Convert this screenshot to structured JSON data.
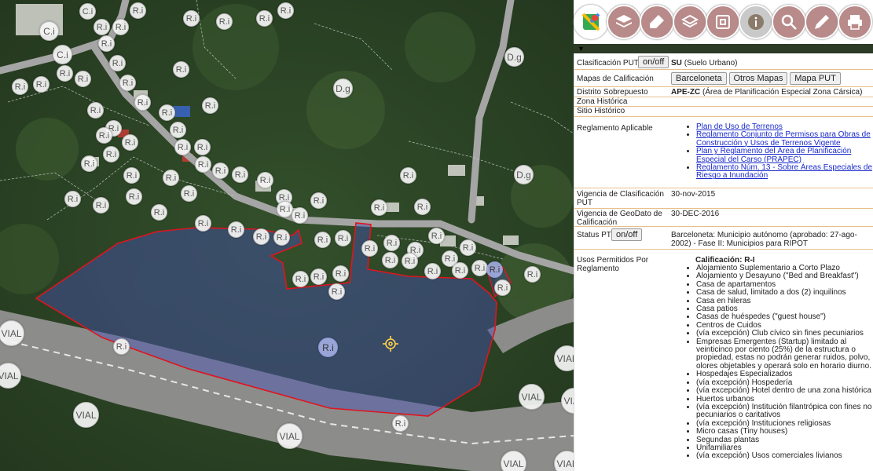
{
  "map": {
    "layer_labels": {
      "ri": "R.i",
      "ci": "C.i",
      "dg": "D.g",
      "vial": "VIAL"
    },
    "location_marker": "crosshair-icon",
    "colors": {
      "parcel_outline": "#e0141e",
      "selected_parcel_fill": "rgba(70,80,180,0.45)",
      "road": "#9a9a9a"
    }
  },
  "toolbar": {
    "buttons": [
      {
        "name": "google-maps-button",
        "icon": "google-maps-icon"
      },
      {
        "name": "layers-button",
        "icon": "layers-icon"
      },
      {
        "name": "eraser-button",
        "icon": "eraser-icon"
      },
      {
        "name": "basemap-button",
        "icon": "stack-icon"
      },
      {
        "name": "gis-button",
        "icon": "gis-icon"
      },
      {
        "name": "info-button",
        "icon": "info-icon"
      },
      {
        "name": "search-button",
        "icon": "magnifier-icon"
      },
      {
        "name": "measure-button",
        "icon": "pencil-icon"
      },
      {
        "name": "print-button",
        "icon": "printer-icon"
      }
    ]
  },
  "panel": {
    "clasificacion_label": "Clasificación PUT",
    "clasificacion_btn": "on/off",
    "clasificacion_code": "SU",
    "clasificacion_desc": "(Suelo Urbano)",
    "mapas_label": "Mapas de Calificación",
    "mapas_buttons": [
      "Barceloneta",
      "Otros Mapas",
      "Mapa PUT"
    ],
    "distrito_label": "Distrito Sobrepuesto",
    "distrito_code": "APE-ZC",
    "distrito_desc": "(Área de Planificación Especial Zona Cársica)",
    "zona_label": "Zona Histórica",
    "sitio_label": "Sitio Histórico",
    "reglamento_label": "Reglamento Aplicable",
    "reglamento_links": [
      "Plan de Uso de Terrenos",
      "Reglamento Conjunto de Permisos para Obras de Construcción y Usos de Terrenos Vigente",
      "Plan y Reglamento del Área de Planificación Especial del Carso (PRAPEC)",
      "Reglamento Núm. 13 - Sobre Áreas Especiales de Riesgo a Inundación"
    ],
    "vig_clas_label": "Vigencia de Clasificación PUT",
    "vig_clas_value": "30-nov-2015",
    "vig_geo_label": "Vigencia de GeoDato de Calificación",
    "vig_geo_value": "30-DEC-2016",
    "status_label": "Status PT",
    "status_btn": "on/off",
    "status_value": "Barceloneta: Municipio autónomo (aprobado: 27-ago-2002) - Fase II: Municipios para RIPOT",
    "usos_label": "Usos Permitidos Por Reglamento",
    "usos_heading": "Calificación: R-I",
    "usos": [
      "Alojamiento Suplementario a Corto Plazo",
      "Alojamiento y Desayuno (\"Bed and Breakfast\")",
      "Casa de apartamentos",
      "Casa de salud, limitado a dos (2) inquilinos",
      "Casa en hileras",
      "Casa patios",
      "Casas de huéspedes (\"guest house\")",
      "Centros de Cuidos",
      "(vía excepción) Club cívico sin fines pecuniarios",
      "Empresas Emergentes (Startup) limitado al veinticinco por ciento (25%) de la estructura o propiedad, estas no podrán generar ruidos, polvo, olores objetables y operará solo en horario diurno.",
      "Hospedajes Especializados",
      "(vía excepción) Hospedería",
      "(vía excepción) Hotel dentro de una zona histórica",
      "Huertos urbanos",
      "(vía excepción) Institución filantrópica con fines no pecuniarios o caritativos",
      "(vía excepción) Instituciones religiosas",
      "Micro casas (Tiny houses)",
      "Segundas plantas",
      "Unifamiliares",
      "(vía excepción) Usos comerciales livianos"
    ]
  }
}
